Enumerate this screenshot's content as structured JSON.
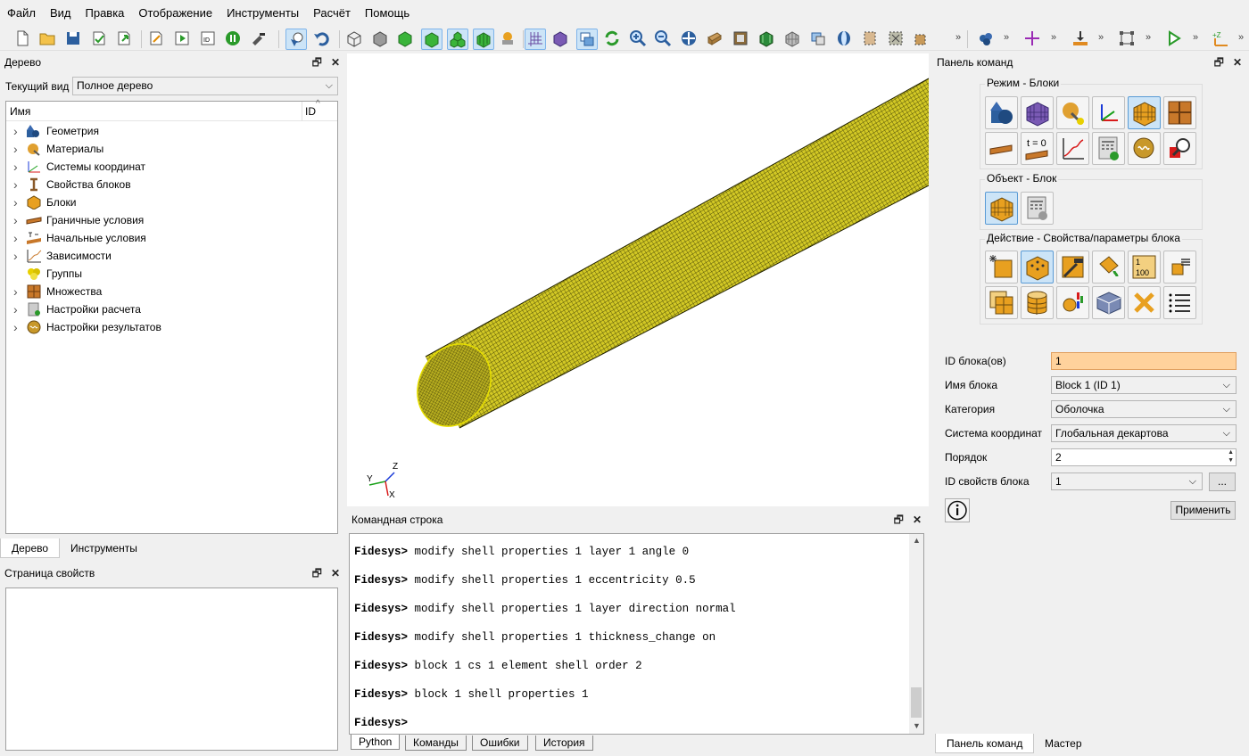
{
  "menu": [
    "Файл",
    "Вид",
    "Правка",
    "Отображение",
    "Инструменты",
    "Расчёт",
    "Помощь"
  ],
  "tree_panel": {
    "title": "Дерево",
    "current_view_label": "Текущий вид",
    "current_view_value": "Полное дерево",
    "col_name": "Имя",
    "col_id": "ID",
    "items": [
      {
        "label": "Геометрия",
        "icon": "geometry-icon",
        "expandable": true
      },
      {
        "label": "Материалы",
        "icon": "materials-icon",
        "expandable": true
      },
      {
        "label": "Системы координат",
        "icon": "coordinate-systems-icon",
        "expandable": true
      },
      {
        "label": "Свойства блоков",
        "icon": "block-properties-icon",
        "expandable": true
      },
      {
        "label": "Блоки",
        "icon": "blocks-icon",
        "expandable": true
      },
      {
        "label": "Граничные условия",
        "icon": "boundary-conditions-icon",
        "expandable": true
      },
      {
        "label": "Начальные условия",
        "icon": "initial-conditions-icon",
        "expandable": true
      },
      {
        "label": "Зависимости",
        "icon": "dependencies-icon",
        "expandable": true
      },
      {
        "label": "Группы",
        "icon": "groups-icon",
        "expandable": false
      },
      {
        "label": "Множества",
        "icon": "sets-icon",
        "expandable": true
      },
      {
        "label": "Настройки расчета",
        "icon": "calc-settings-icon",
        "expandable": true
      },
      {
        "label": "Настройки результатов",
        "icon": "results-settings-icon",
        "expandable": true
      }
    ],
    "tabs": [
      "Дерево",
      "Инструменты"
    ]
  },
  "properties_panel": {
    "title": "Страница свойств"
  },
  "command_line": {
    "title": "Командная строка",
    "prompt": "Fidesys>",
    "lines": [
      "modify shell properties 1 layer 1 angle 0",
      "modify shell properties 1 eccentricity 0.5",
      "modify shell properties 1 layer direction normal",
      "modify shell properties 1 thickness_change on",
      "block 1 cs 1 element shell order 2",
      "block 1 shell properties 1",
      ""
    ],
    "tabs": [
      "Python",
      "Команды",
      "Ошибки",
      "История"
    ],
    "selected_tab": "Команды"
  },
  "viewport": {
    "axis_labels": {
      "y": "Y",
      "z": "Z",
      "x": "X"
    },
    "mesh_color": "#d2c825"
  },
  "command_panel": {
    "title": "Панель команд",
    "mode_title": "Режим - Блоки",
    "object_title": "Объект - Блок",
    "action_title": "Действие - Свойства/параметры блока",
    "t0_label": "t = 0",
    "range_label_top": "1",
    "range_label_bottom": "100",
    "fields": {
      "block_ids_label": "ID блока(ов)",
      "block_ids_value": "1",
      "block_name_label": "Имя блока",
      "block_name_value": "Block 1 (ID 1)",
      "category_label": "Категория",
      "category_value": "Оболочка",
      "cs_label": "Система координат",
      "cs_value": "Глобальная декартова",
      "order_label": "Порядок",
      "order_value": "2",
      "props_id_label": "ID свойств блока",
      "props_id_value": "1",
      "browse_label": "...",
      "apply_label": "Применить"
    },
    "tabs": [
      "Панель команд",
      "Мастер"
    ]
  },
  "colors": {
    "accent_selection": "#cce4f7",
    "block_id_highlight": "#ffd29c"
  }
}
